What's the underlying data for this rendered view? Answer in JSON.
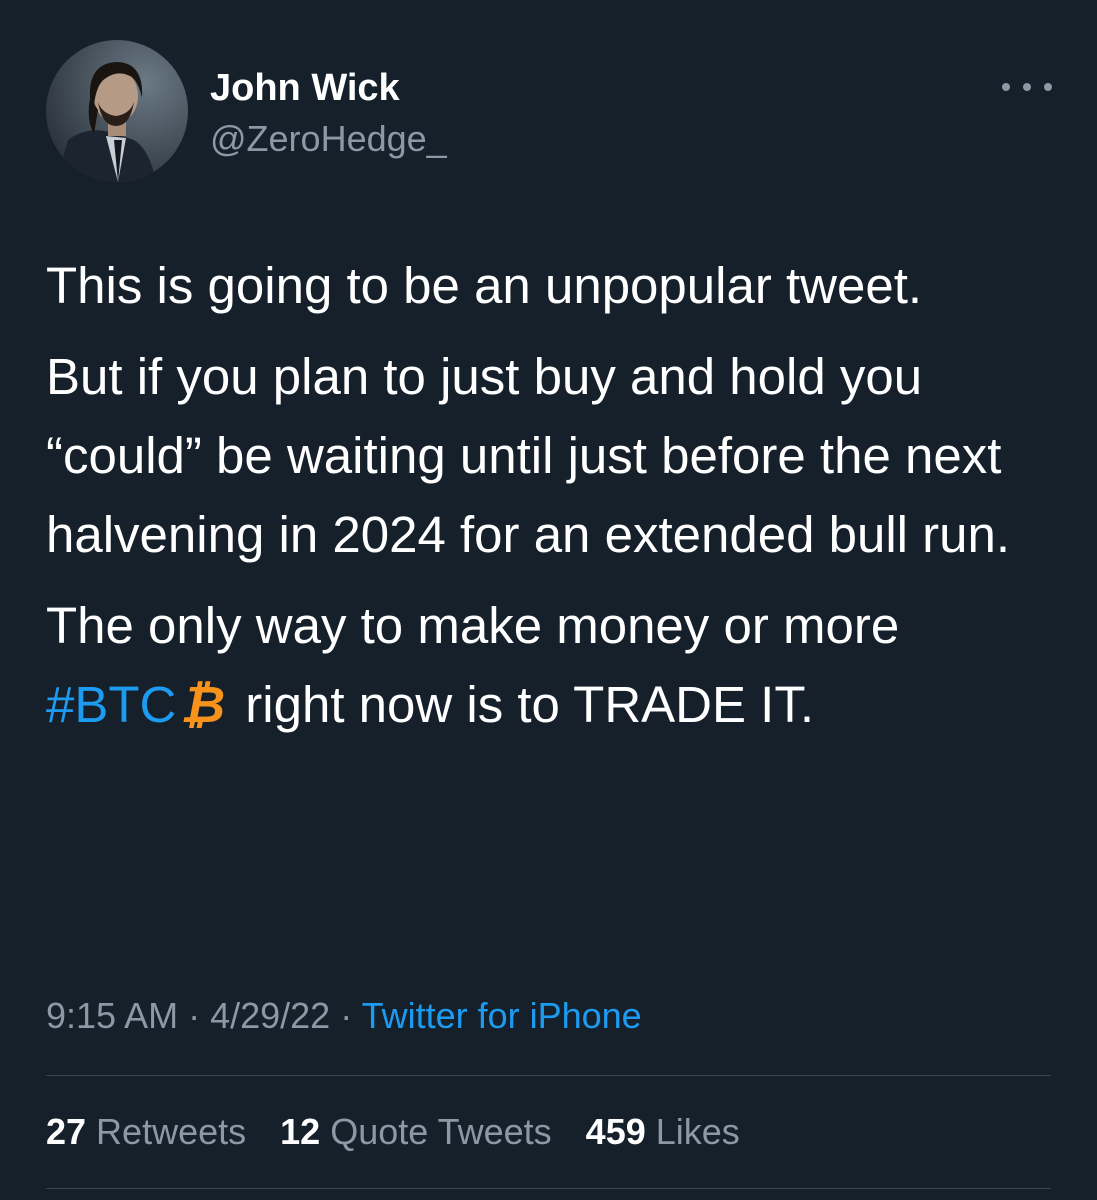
{
  "user": {
    "name": "John Wick",
    "handle": "@ZeroHedge_"
  },
  "tweet": {
    "paragraph1": "This is going to be an unpopular tweet.",
    "paragraph2": "But if you plan to just buy and hold you “could” be waiting until just before the next halvening in 2024 for an extended bull run.",
    "paragraph3_start": "The only way to make money or more",
    "hashtag": "#BTC",
    "btc_symbol": "₿",
    "paragraph3_end": "right now is to TRADE IT."
  },
  "meta": {
    "time": "9:15 AM",
    "separator1": " · ",
    "date": "4/29/22",
    "separator2": " · ",
    "source": "Twitter for iPhone"
  },
  "stats": {
    "retweets_count": "27",
    "retweets_label": "Retweets",
    "quotes_count": "12",
    "quotes_label": "Quote Tweets",
    "likes_count": "459",
    "likes_label": "Likes"
  },
  "colors": {
    "background": "#15202b",
    "link": "#1d9bf0",
    "secondary_text": "#8b98a5",
    "bitcoin": "#f7931a"
  },
  "icons": {
    "more": "more-horizontal-icon",
    "avatar": "profile-avatar"
  }
}
